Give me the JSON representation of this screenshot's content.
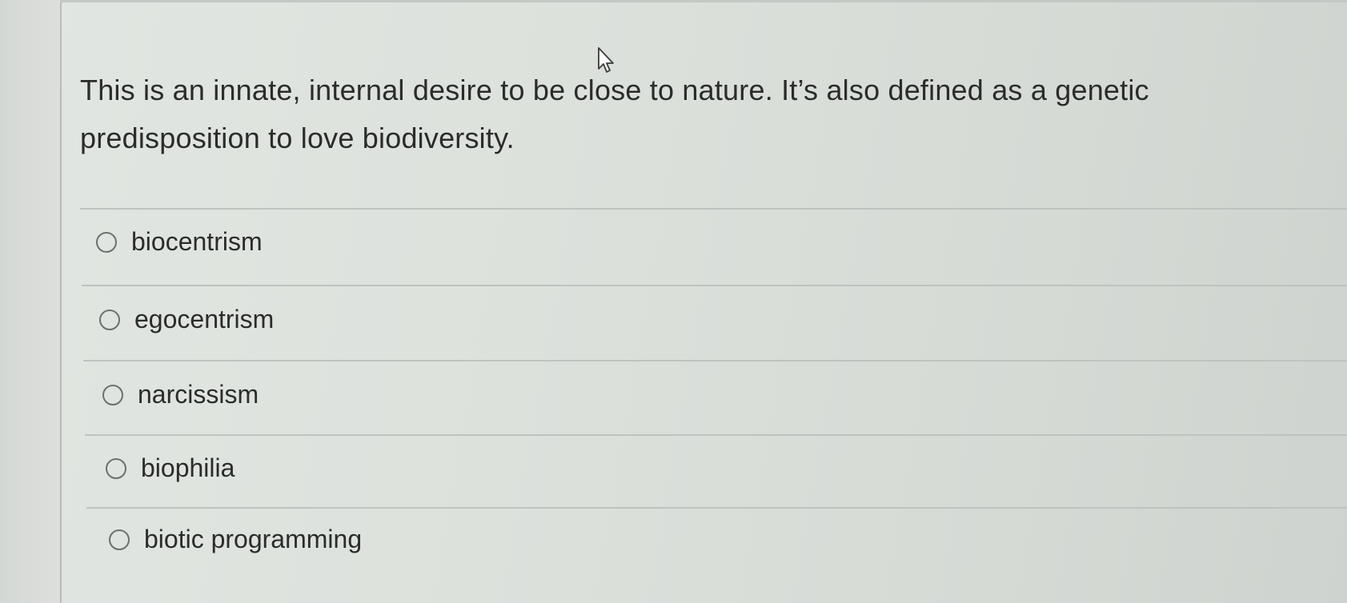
{
  "question": {
    "line1": "This is an innate, internal desire to be close to nature. It’s also defined as a genetic",
    "line2": "predisposition to love biodiversity."
  },
  "options": [
    {
      "label": "biocentrism",
      "selected": false
    },
    {
      "label": "egocentrism",
      "selected": false
    },
    {
      "label": "narcissism",
      "selected": false
    },
    {
      "label": "biophilia",
      "selected": false
    },
    {
      "label": "biotic programming",
      "selected": false
    }
  ],
  "icons": {
    "cursor": "mouse-pointer-icon",
    "radio": "radio-button-icon"
  },
  "colors": {
    "text": "#2a2c2b",
    "radio_border": "#6d706e",
    "divider": "#bfc3bf"
  }
}
